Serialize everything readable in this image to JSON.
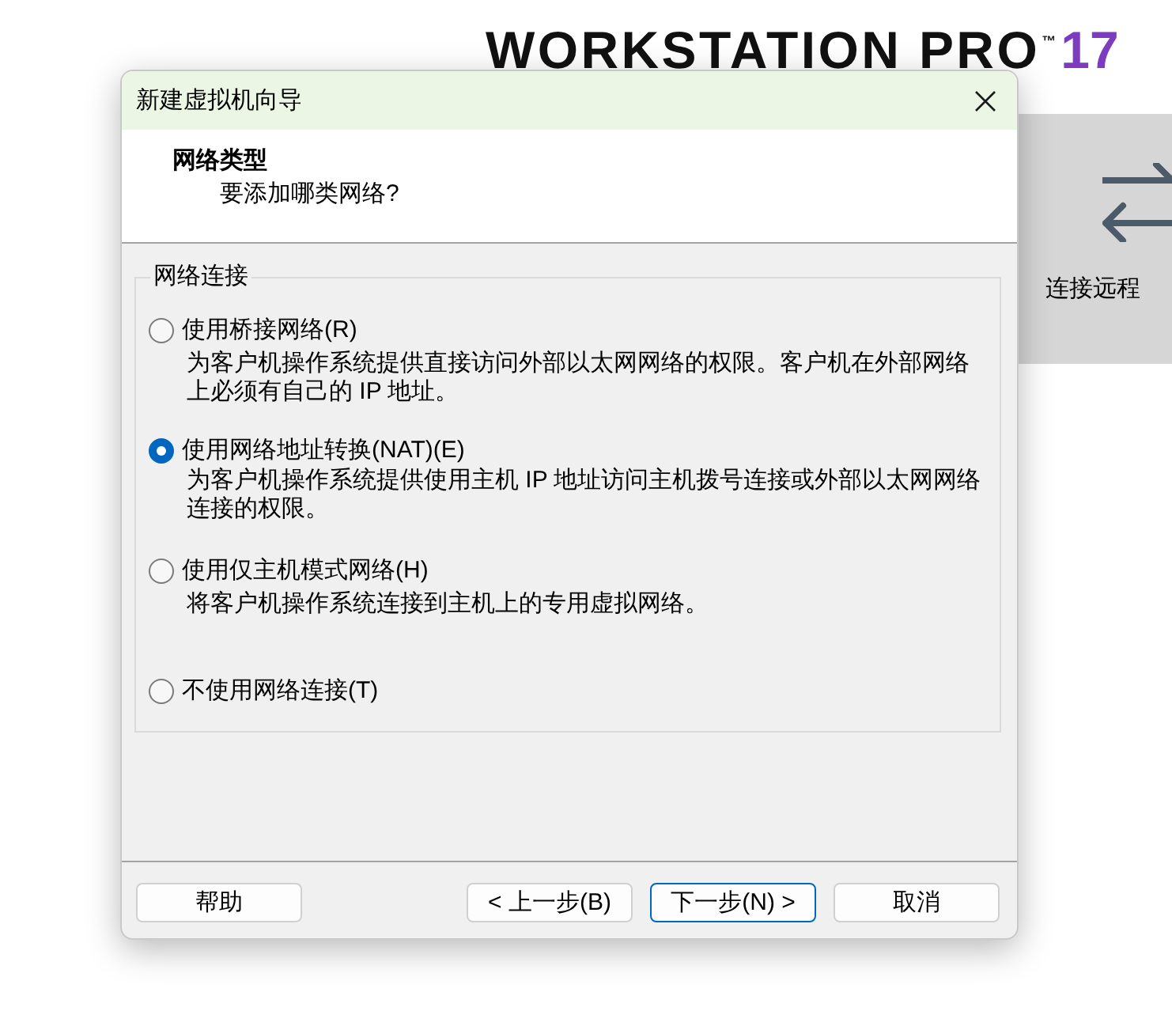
{
  "background_app": {
    "logo": {
      "name": "WORKSTATION PRO",
      "trademark": "™",
      "version": "17"
    },
    "tile": {
      "label": "连接远程"
    }
  },
  "dialog": {
    "title": "新建虚拟机向导",
    "header": {
      "title": "网络类型",
      "subtitle": "要添加哪类网络?"
    },
    "group": {
      "title": "网络连接",
      "options": [
        {
          "label": "使用桥接网络(R)",
          "description": "为客户机操作系统提供直接访问外部以太网网络的权限。客户机在外部网络上必须有自己的 IP 地址。",
          "selected": false
        },
        {
          "label": "使用网络地址转换(NAT)(E)",
          "description": "为客户机操作系统提供使用主机 IP 地址访问主机拨号连接或外部以太网网络连接的权限。",
          "selected": true
        },
        {
          "label": "使用仅主机模式网络(H)",
          "description": "将客户机操作系统连接到主机上的专用虚拟网络。",
          "selected": false
        },
        {
          "label": "不使用网络连接(T)",
          "selected": false
        }
      ]
    },
    "buttons": [
      {
        "label": "帮助",
        "default": false
      },
      {
        "label": "< 上一步(B)",
        "default": false
      },
      {
        "label": "下一步(N) >",
        "default": true
      },
      {
        "label": "取消",
        "default": false
      }
    ]
  }
}
